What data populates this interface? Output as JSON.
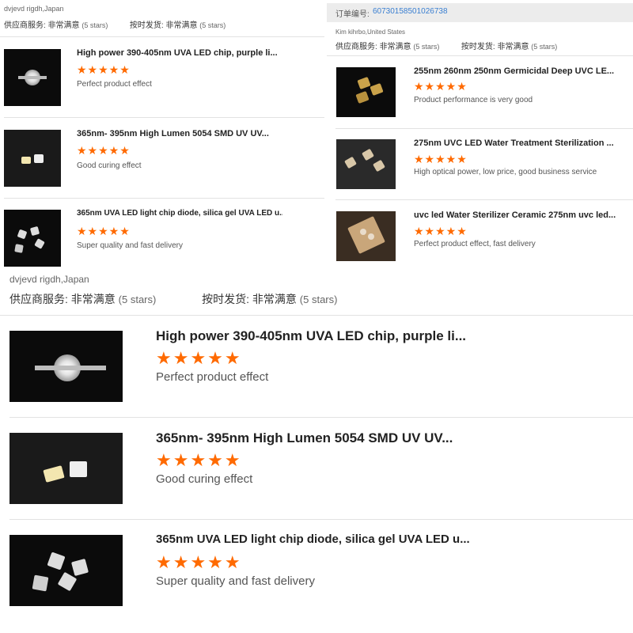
{
  "panel_a": {
    "reviewer": "dvjevd rigdh,Japan",
    "supplier_label": "供应商服务:",
    "supplier_value": "非常满意",
    "supplier_stars": "(5 stars)",
    "delivery_label": "按时发货:",
    "delivery_value": "非常满意",
    "delivery_stars": "(5 stars)",
    "items": [
      {
        "title": "High power 390-405nm UVA LED chip, purple li...",
        "stars": "★★★★★",
        "comment": "Perfect product effect",
        "thumb_icon": "led-bead-image"
      },
      {
        "title": "365nm- 395nm High Lumen 5054 SMD UV UV...",
        "stars": "★★★★★",
        "comment": "Good curing effect",
        "thumb_icon": "smd-led-image"
      },
      {
        "title": "365nm UVA LED light chip diode, silica gel UVA LED u...",
        "stars": "★★★★★",
        "comment": "Super quality and fast delivery",
        "thumb_icon": "led-chips-image"
      }
    ]
  },
  "panel_b": {
    "order_label": "订单编号:",
    "order_number": "60730158501026738",
    "reviewer": "Kim kihrbo,United States",
    "supplier_label": "供应商服务:",
    "supplier_value": "非常满意",
    "supplier_stars": "(5 stars)",
    "delivery_label": "按时发货:",
    "delivery_value": "非常满意",
    "delivery_stars": "(5 stars)",
    "items": [
      {
        "title": "255nm 260nm 250nm Germicidal Deep UVC LE...",
        "stars": "★★★★★",
        "comment": "Product performance is very good",
        "thumb_icon": "uvc-chip-image"
      },
      {
        "title": "275nm UVC LED Water Treatment Sterilization ...",
        "stars": "★★★★★",
        "comment": "High optical power, low price, good business service",
        "thumb_icon": "uvc-led-image"
      },
      {
        "title": "uvc led Water Sterilizer Ceramic 275nm uvc led...",
        "stars": "★★★★★",
        "comment": "Perfect product effect, fast delivery",
        "thumb_icon": "ceramic-led-image"
      }
    ]
  },
  "panel_c": {
    "reviewer": "dvjevd rigdh,Japan",
    "supplier_label": "供应商服务:",
    "supplier_value": "非常满意",
    "supplier_stars": "(5 stars)",
    "delivery_label": "按时发货:",
    "delivery_value": "非常满意",
    "delivery_stars": "(5 stars)",
    "items": [
      {
        "title": "High power 390-405nm UVA LED chip, purple li...",
        "stars": "★★★★★",
        "comment": "Perfect product effect"
      },
      {
        "title": "365nm- 395nm High Lumen 5054 SMD UV UV...",
        "stars": "★★★★★",
        "comment": "Good curing effect"
      },
      {
        "title": "365nm UVA LED light chip diode, silica gel UVA LED u...",
        "stars": "★★★★★",
        "comment": "Super quality and fast delivery"
      }
    ]
  },
  "colors": {
    "star": "#ff6a00",
    "order_number": "#3a7fd1",
    "order_bar_bg": "#ececec"
  }
}
